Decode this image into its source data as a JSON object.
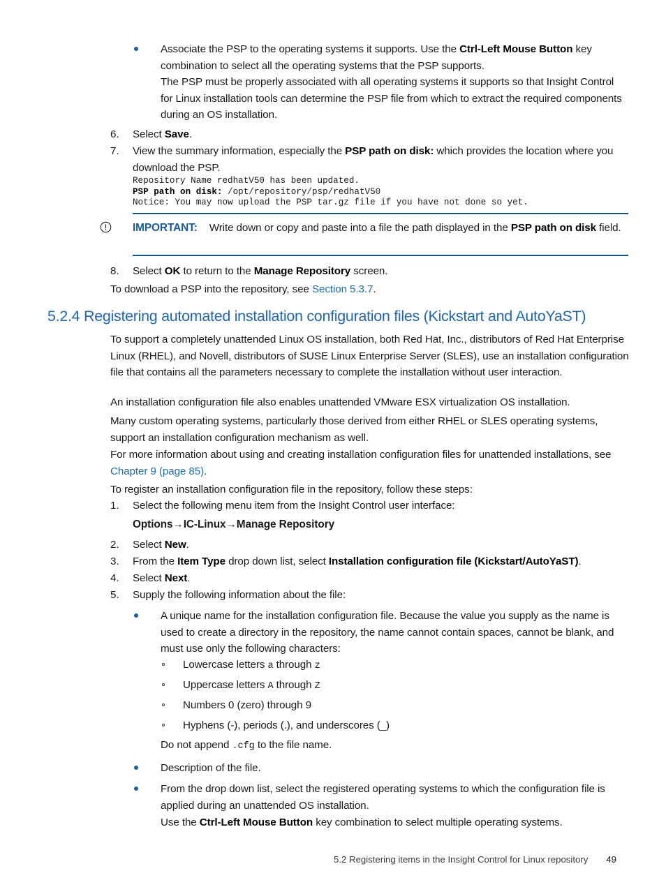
{
  "page": {
    "number": "49",
    "footer_text": "5.2 Registering items in the Insight Control for Linux repository"
  },
  "top_bullet": {
    "line1_a": "Associate the PSP to the operating systems it supports. Use the ",
    "line1_b": "Ctrl-Left Mouse Button",
    "line1_c": " key combination to select all the operating systems that the PSP supports.",
    "para2": "The PSP must be properly associated with all operating systems it supports so that Insight Control for Linux installation tools can determine the PSP file from which to extract the required components during an OS installation."
  },
  "steps_top": [
    {
      "num": "6.",
      "text_a": "Select ",
      "text_b": "Save",
      "text_c": "."
    },
    {
      "num": "7.",
      "text_a": "View the summary information, especially the ",
      "text_b": "PSP path on disk:",
      "text_c": " which provides the location where you download the PSP."
    }
  ],
  "code_block": {
    "line1": "Repository Name redhatV50 has been updated.",
    "line2_bold": "PSP path on disk:",
    "line2_rest": " /opt/repository/psp/redhatV50",
    "line3": "Notice: You may now upload the PSP tar.gz file if you have not done so yet."
  },
  "important": {
    "icon": "important-circle-exclamation-icon",
    "label": "IMPORTANT:",
    "text_a": "Write down or copy and paste into a file the path displayed in the ",
    "text_b": "PSP path on disk",
    "text_c": " field."
  },
  "step8": {
    "num": "8.",
    "text_a": "Select ",
    "text_b": "OK",
    "text_c": " to return to the ",
    "text_d": "Manage Repository",
    "text_e": " screen."
  },
  "download_note": {
    "text_a": "To download a PSP into the repository, see ",
    "link": "Section 5.3.7",
    "text_b": "."
  },
  "section": {
    "heading": "5.2.4 Registering automated installation configuration files (Kickstart and AutoYaST)",
    "paragraphs": [
      "To support a completely unattended Linux OS installation, both Red Hat, Inc., distributors of Red Hat Enterprise Linux (RHEL), and Novell, distributors of SUSE Linux Enterprise Server (SLES), use an installation configuration file that contains all the parameters necessary to complete the installation without user interaction.",
      "An installation configuration file also enables unattended VMware ESX virtualization OS installation.",
      "Many custom operating systems, particularly those derived from either RHEL or SLES operating systems, support an installation configuration mechanism as well."
    ],
    "chapter_ref": {
      "text_a": "For more information about using and creating installation configuration files for unattended installations, see ",
      "link": "Chapter 9 (page 85)",
      "text_b": "."
    },
    "intro_steps": "To register an installation configuration file in the repository, follow these steps:"
  },
  "steps": [
    {
      "num": "1.",
      "text": "Select the following menu item from the Insight Control user interface:",
      "sub_bold": "Options→IC-Linux→Manage Repository"
    },
    {
      "num": "2.",
      "text_a": "Select ",
      "text_b": "New",
      "text_c": "."
    },
    {
      "num": "3.",
      "text_a": "From the ",
      "text_b": "Item Type",
      "text_c": " drop down list, select ",
      "text_d": "Installation configuration file (Kickstart/AutoYaST)",
      "text_e": "."
    },
    {
      "num": "4.",
      "text_a": "Select ",
      "text_b": "Next",
      "text_c": "."
    },
    {
      "num": "5.",
      "text": "Supply the following information about the file:"
    }
  ],
  "step5_bullets": {
    "first": "A unique name for the installation configuration file. Because the value you supply as the name is used to create a directory in the repository, the name cannot contain spaces, cannot be blank, and must use only the following characters:",
    "char_rules": [
      {
        "pre": "Lowercase letters ",
        "mono1": "a",
        "mid": " through ",
        "mono2": "z"
      },
      {
        "pre": "Uppercase letters ",
        "mono1": "A",
        "mid": " through ",
        "mono2": "Z"
      },
      {
        "pre": "Numbers 0 (zero) through 9",
        "mono1": "",
        "mid": "",
        "mono2": ""
      },
      {
        "pre": "Hyphens (-), periods (.), and underscores (_)",
        "mono1": "",
        "mid": "",
        "mono2": ""
      }
    ],
    "no_append_a": "Do not append ",
    "no_append_mono": ".cfg",
    "no_append_b": " to the file name.",
    "second": "Description of the file.",
    "third": "From the drop down list, select the registered operating systems to which the configuration file is applied during an unattended OS installation.",
    "third_note_a": "Use the ",
    "third_note_b": "Ctrl-Left Mouse Button",
    "third_note_c": " key combination to select multiple operating systems."
  },
  "colors": {
    "heading_blue": "#2266ab",
    "link_blue": "#1f6cb0",
    "important_blue": "#1a5a96",
    "rule_blue": "#14568c",
    "bullet_blue": "#1f5d9e"
  }
}
